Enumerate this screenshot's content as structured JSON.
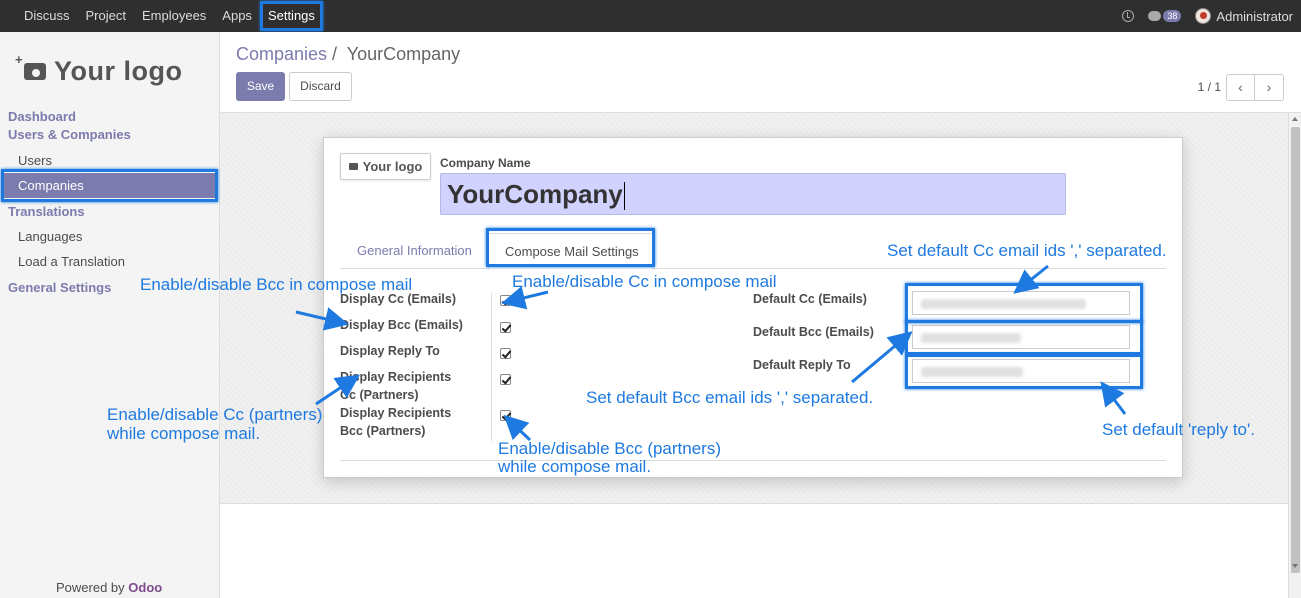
{
  "topbar": {
    "items": [
      "Discuss",
      "Project",
      "Employees",
      "Apps",
      "Settings"
    ],
    "active": "Settings",
    "message_count": "38",
    "user": "Administrator"
  },
  "sidebar": {
    "logo_text": "Your logo",
    "dashboard": "Dashboard",
    "users_companies": "Users & Companies",
    "users": "Users",
    "companies": "Companies",
    "translations": "Translations",
    "languages": "Languages",
    "load_translation": "Load a Translation",
    "general_settings": "General Settings",
    "powered_prefix": "Powered by",
    "powered_brand": "Odoo"
  },
  "control": {
    "breadcrumb_parent": "Companies",
    "breadcrumb_sep": " / ",
    "breadcrumb_current": "YourCompany",
    "save_label": "Save",
    "discard_label": "Discard",
    "pager": "1 / 1",
    "prev_glyph": "‹",
    "next_glyph": "›"
  },
  "form": {
    "logo_text": "Your logo",
    "company_name_label": "Company Name",
    "company_name_value": "YourCompany",
    "tabs": [
      "General Information",
      "Compose Mail Settings"
    ],
    "active_tab": "Compose Mail Settings",
    "left_fields": [
      {
        "label": "Display Cc (Emails)",
        "checked": true
      },
      {
        "label": "Display Bcc (Emails)",
        "checked": true
      },
      {
        "label": "Display Reply To",
        "checked": true
      },
      {
        "label_line1": "Display Recipients",
        "label_line2": "Cc (Partners)",
        "checked": true
      },
      {
        "label_line1": "Display Recipients",
        "label_line2": "Bcc (Partners)",
        "checked": true
      }
    ],
    "right_fields": [
      "Default Cc (Emails)",
      "Default Bcc (Emails)",
      "Default Reply To"
    ]
  },
  "annotations": {
    "bcc_compose": "Enable/disable Bcc in compose mail",
    "cc_compose": "Enable/disable Cc in compose mail",
    "cc_partners_1": "Enable/disable Cc (partners)",
    "cc_partners_2": "while compose mail.",
    "bcc_partners_1": "Enable/disable Bcc (partners)",
    "bcc_partners_2": "while compose mail.",
    "default_cc": "Set default Cc email ids ',' separated.",
    "default_bcc": "Set default Bcc email ids ',' separated.",
    "default_reply": "Set default 'reply to'."
  },
  "colors": {
    "accent": "#7c7bad",
    "annotation": "#1e7ae0",
    "topbar": "#2f2f2f"
  }
}
